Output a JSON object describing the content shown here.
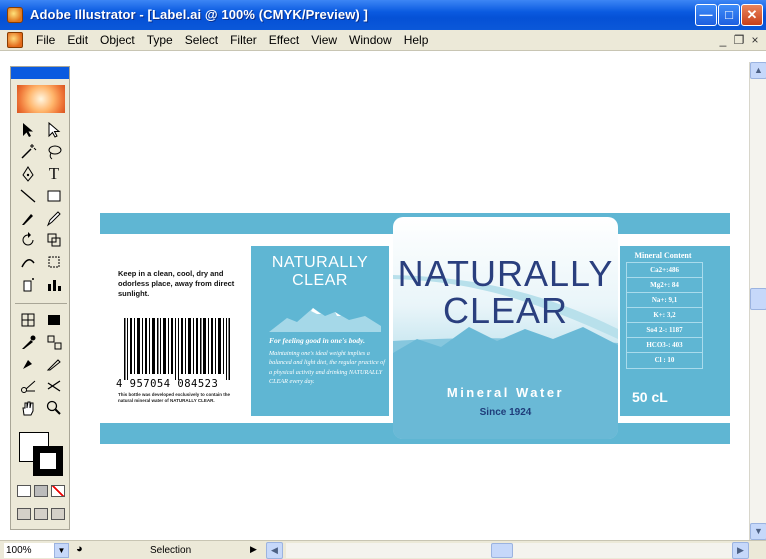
{
  "window": {
    "title": "Adobe Illustrator - [Label.ai @ 100% (CMYK/Preview) ]",
    "minimize_icon": "minimize-icon",
    "maximize_icon": "maximize-icon",
    "close_icon": "close-icon"
  },
  "menubar": {
    "items": [
      "File",
      "Edit",
      "Object",
      "Type",
      "Select",
      "Filter",
      "Effect",
      "View",
      "Window",
      "Help"
    ],
    "doc_minimize": "_",
    "doc_restore": "❐",
    "doc_close": "×"
  },
  "label": {
    "storage_text": "Keep in a clean, cool, dry and odorless place, away from direct sunlight.",
    "barcode_number": "4 957054 084523",
    "bottle_note": "This bottle was developed exclusively to contain the natural mineral water of NATURALLY CLEAR.",
    "small_brand_line1": "NATURALLY",
    "small_brand_line2": "CLEAR",
    "slogan": "For feeling good in one's body.",
    "body_copy": "Maintaining one's ideal weight implies a balanced and light diet, the regular practice of a physical activity and drinking NATURALLY CLEAR every day.",
    "brand_line1": "NATURALLY",
    "brand_line2": "CLEAR",
    "product_type": "Mineral Water",
    "since": "Since 1924",
    "mineral_title": "Mineral Content",
    "minerals": [
      "Ca2+:486",
      "Mg2+: 84",
      "Na+: 9,1",
      "K+: 3,2",
      "So4 2-: 1187",
      "HCO3-: 403",
      "Cl : 10"
    ],
    "volume": "50 cL"
  },
  "status": {
    "zoom": "100%",
    "tool": "Selection"
  },
  "colors": {
    "label_blue": "#5fb6d3",
    "brand_navy": "#2a3f7e",
    "xp_blue": "#0a5ae0"
  }
}
